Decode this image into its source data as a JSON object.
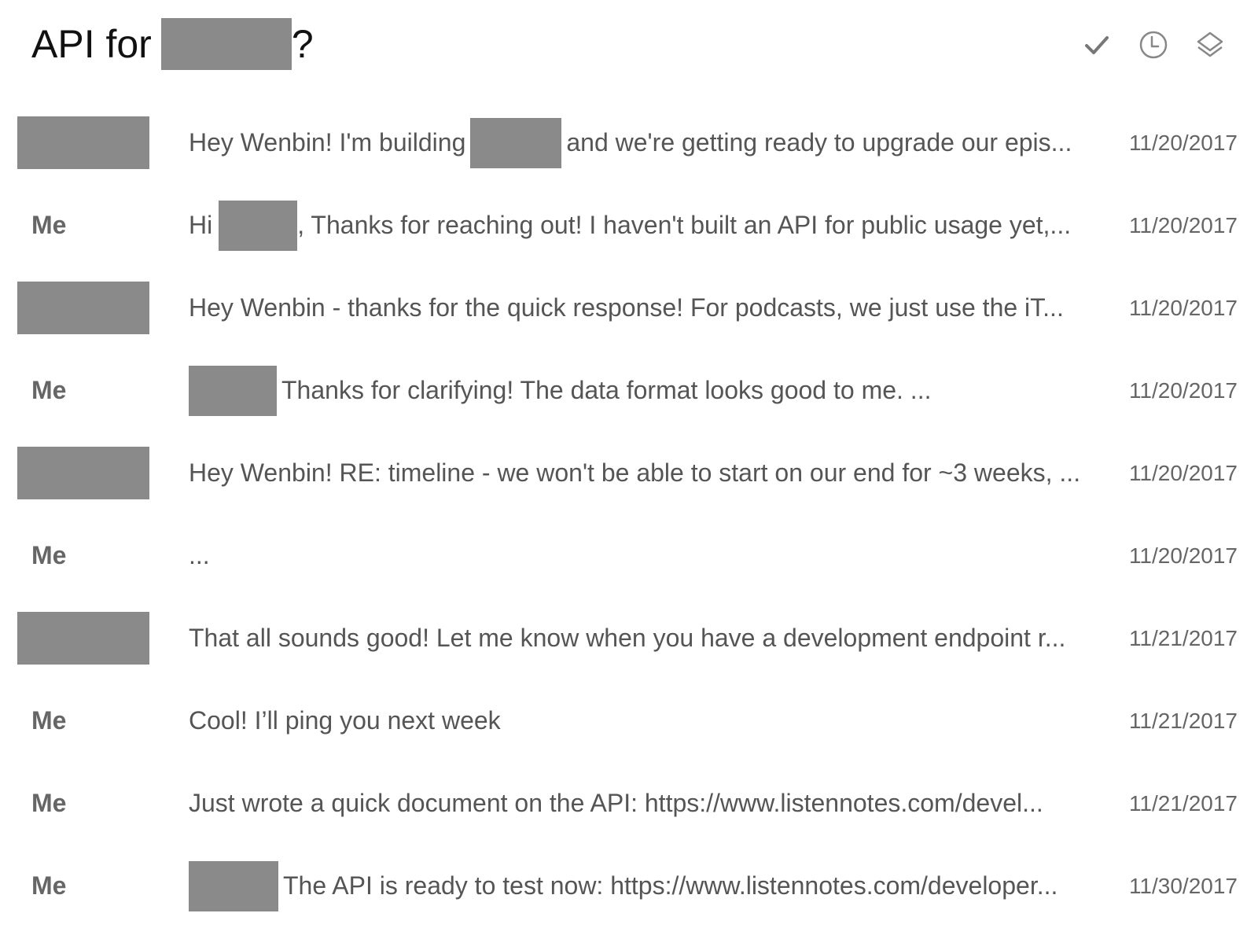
{
  "header": {
    "subject_prefix": "API for",
    "subject_suffix": "?",
    "actions": [
      {
        "icon": "check-icon",
        "label": "Mark done"
      },
      {
        "icon": "clock-icon",
        "label": "Snooze"
      },
      {
        "icon": "layers-icon",
        "label": "Move"
      }
    ]
  },
  "messages": [
    {
      "sender": "",
      "sender_redacted": true,
      "snippet_a": "Hey Wenbin! I'm building",
      "snippet_b": "and we're getting ready to upgrade our epis...",
      "date": "11/20/2017"
    },
    {
      "sender": "Me",
      "snippet_a": "Hi",
      "snippet_b": ", Thanks for reaching out! I haven't built an API for public usage yet,...",
      "date": "11/20/2017"
    },
    {
      "sender": "",
      "sender_redacted": true,
      "snippet_a": "Hey Wenbin - thanks for the quick response! For podcasts, we just use the iT...",
      "date": "11/20/2017"
    },
    {
      "sender": "Me",
      "snippet_a": "",
      "snippet_b": "Thanks for clarifying! The data format looks good to me. ...",
      "date": "11/20/2017"
    },
    {
      "sender": "",
      "sender_redacted": true,
      "snippet_a": "Hey Wenbin! RE: timeline - we won't be able to start on our end for ~3 weeks, ...",
      "date": "11/20/2017"
    },
    {
      "sender": "Me",
      "snippet_a": "...",
      "date": "11/20/2017"
    },
    {
      "sender": "",
      "sender_redacted": true,
      "snippet_a": "That all sounds good! Let me know when you have a development endpoint r...",
      "date": "11/21/2017"
    },
    {
      "sender": "Me",
      "snippet_a": "Cool! I’ll ping you next week",
      "date": "11/21/2017"
    },
    {
      "sender": "Me",
      "snippet_a": "Just wrote a quick document on the API: https://www.listennotes.com/devel...",
      "date": "11/21/2017"
    },
    {
      "sender": "Me",
      "snippet_a": "",
      "snippet_b": "The API is ready to test now: https://www.listennotes.com/developer...",
      "date": "11/30/2017"
    }
  ]
}
